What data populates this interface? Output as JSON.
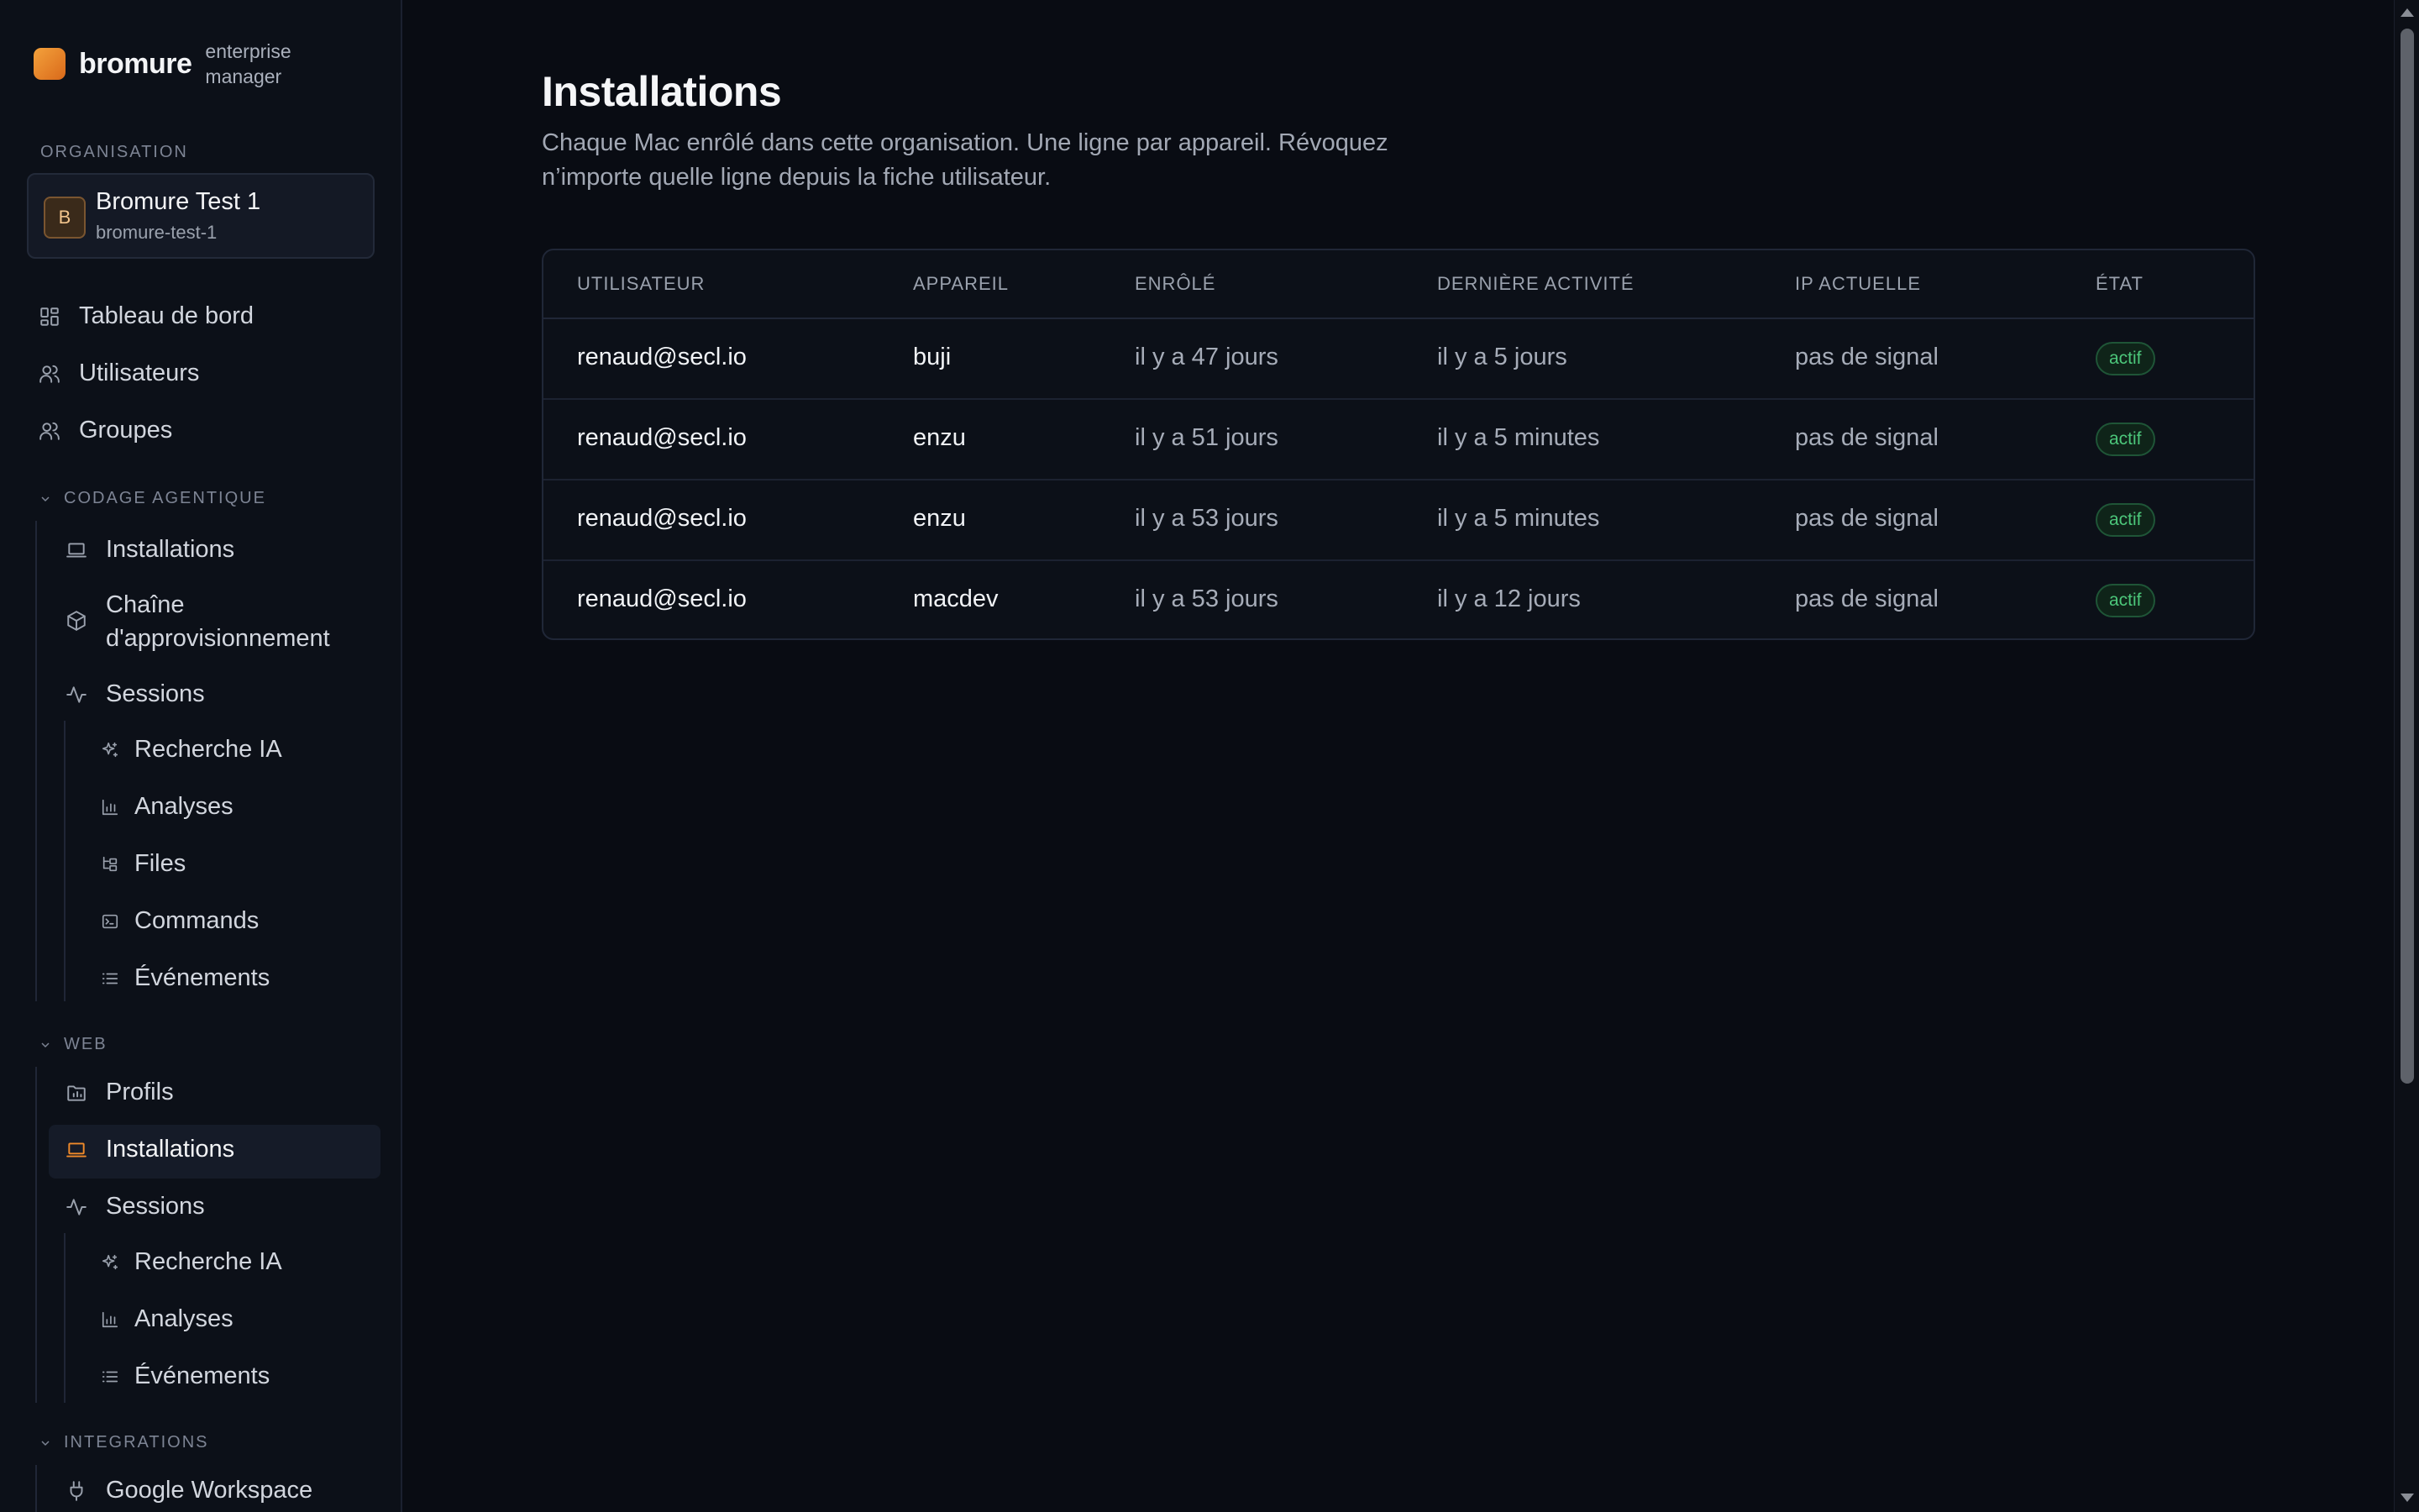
{
  "brand": {
    "name": "bromure",
    "subtitle": "enterprise manager"
  },
  "org": {
    "section_label": "ORGANISATION",
    "avatar": "B",
    "name": "Bromure Test 1",
    "slug": "bromure-test-1"
  },
  "nav": {
    "dashboard": "Tableau de bord",
    "users": "Utilisateurs",
    "groups": "Groupes",
    "agentic_label": "CODAGE AGENTIQUE",
    "agentic": {
      "installations": "Installations",
      "supply_chain": "Chaîne d'approvisionnement",
      "sessions": "Sessions",
      "ai_search": "Recherche IA",
      "analyses": "Analyses",
      "files": "Files",
      "commands": "Commands",
      "events": "Événements"
    },
    "web_label": "WEB",
    "web": {
      "profiles": "Profils",
      "installations": "Installations",
      "sessions": "Sessions",
      "ai_search": "Recherche IA",
      "analyses": "Analyses",
      "events": "Événements"
    },
    "integrations_label": "INTEGRATIONS",
    "integrations": {
      "google": "Google Workspace"
    }
  },
  "page": {
    "title": "Installations",
    "description": "Chaque Mac enrôlé dans cette organisation. Une ligne par appareil. Révoquez n’importe quelle ligne depuis la fiche utilisateur."
  },
  "table": {
    "columns": [
      "UTILISATEUR",
      "APPAREIL",
      "ENRÔLÉ",
      "DERNIÈRE ACTIVITÉ",
      "IP ACTUELLE",
      "ÉTAT"
    ],
    "rows": [
      {
        "user": "renaud@secl.io",
        "device": "buji",
        "enrolled": "il y a 47 jours",
        "last_activity": "il y a 5 jours",
        "ip": "pas de signal",
        "status": "actif"
      },
      {
        "user": "renaud@secl.io",
        "device": "enzu",
        "enrolled": "il y a 51 jours",
        "last_activity": "il y a 5 minutes",
        "ip": "pas de signal",
        "status": "actif"
      },
      {
        "user": "renaud@secl.io",
        "device": "enzu",
        "enrolled": "il y a 53 jours",
        "last_activity": "il y a 5 minutes",
        "ip": "pas de signal",
        "status": "actif"
      },
      {
        "user": "renaud@secl.io",
        "device": "macdev",
        "enrolled": "il y a 53 jours",
        "last_activity": "il y a 12 jours",
        "ip": "pas de signal",
        "status": "actif"
      }
    ]
  },
  "colors": {
    "accent": "#ef8a2a",
    "status_active": "#4cc67a",
    "background": "#090c13"
  }
}
